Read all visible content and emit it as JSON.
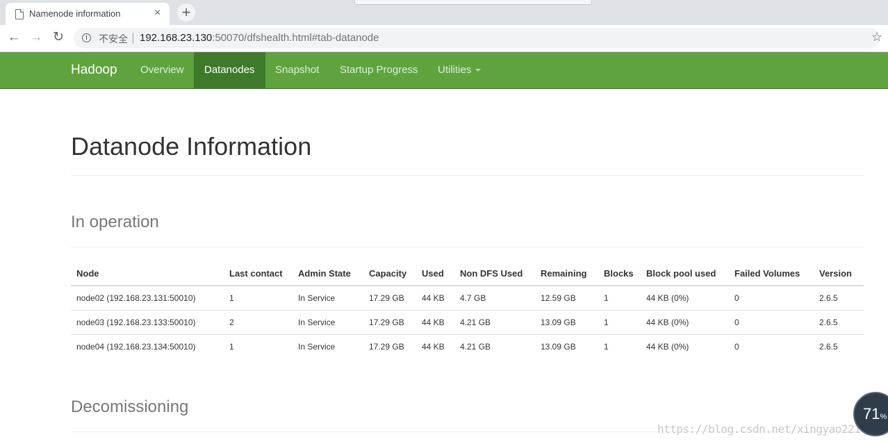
{
  "browser": {
    "tab_title": "Namenode information",
    "close_glyph": "×",
    "new_tab_glyph": "+",
    "back_glyph": "←",
    "forward_glyph": "→",
    "reload_glyph": "↻",
    "info_glyph": "i",
    "security_label": "不安全",
    "url_host": "192.168.23.130",
    "url_rest": ":50070/dfshealth.html#tab-datanode",
    "star_glyph": "☆"
  },
  "navbar": {
    "brand": "Hadoop",
    "items": [
      {
        "label": "Overview"
      },
      {
        "label": "Datanodes",
        "active": true
      },
      {
        "label": "Snapshot"
      },
      {
        "label": "Startup Progress"
      },
      {
        "label": "Utilities"
      }
    ],
    "color": "#5fa33e",
    "active_color": "#3f7a2a"
  },
  "page": {
    "title": "Datanode Information",
    "in_operation": "In operation",
    "decomissioning": "Decomissioning"
  },
  "table": {
    "headers": [
      "Node",
      "Last contact",
      "Admin State",
      "Capacity",
      "Used",
      "Non DFS Used",
      "Remaining",
      "Blocks",
      "Block pool used",
      "Failed Volumes",
      "Version"
    ],
    "rows": [
      [
        "node02 (192.168.23.131:50010)",
        "1",
        "In Service",
        "17.29 GB",
        "44 KB",
        "4.7 GB",
        "12.59 GB",
        "1",
        "44 KB (0%)",
        "0",
        "2.6.5"
      ],
      [
        "node03 (192.168.23.133:50010)",
        "2",
        "In Service",
        "17.29 GB",
        "44 KB",
        "4.21 GB",
        "13.09 GB",
        "1",
        "44 KB (0%)",
        "0",
        "2.6.5"
      ],
      [
        "node04 (192.168.23.134:50010)",
        "1",
        "In Service",
        "17.29 GB",
        "44 KB",
        "4.21 GB",
        "13.09 GB",
        "1",
        "44 KB (0%)",
        "0",
        "2.6.5"
      ]
    ]
  },
  "overlay": {
    "perf_value": "71",
    "perf_unit": "%",
    "watermark": "https://blog.csdn.net/xingyao221"
  }
}
